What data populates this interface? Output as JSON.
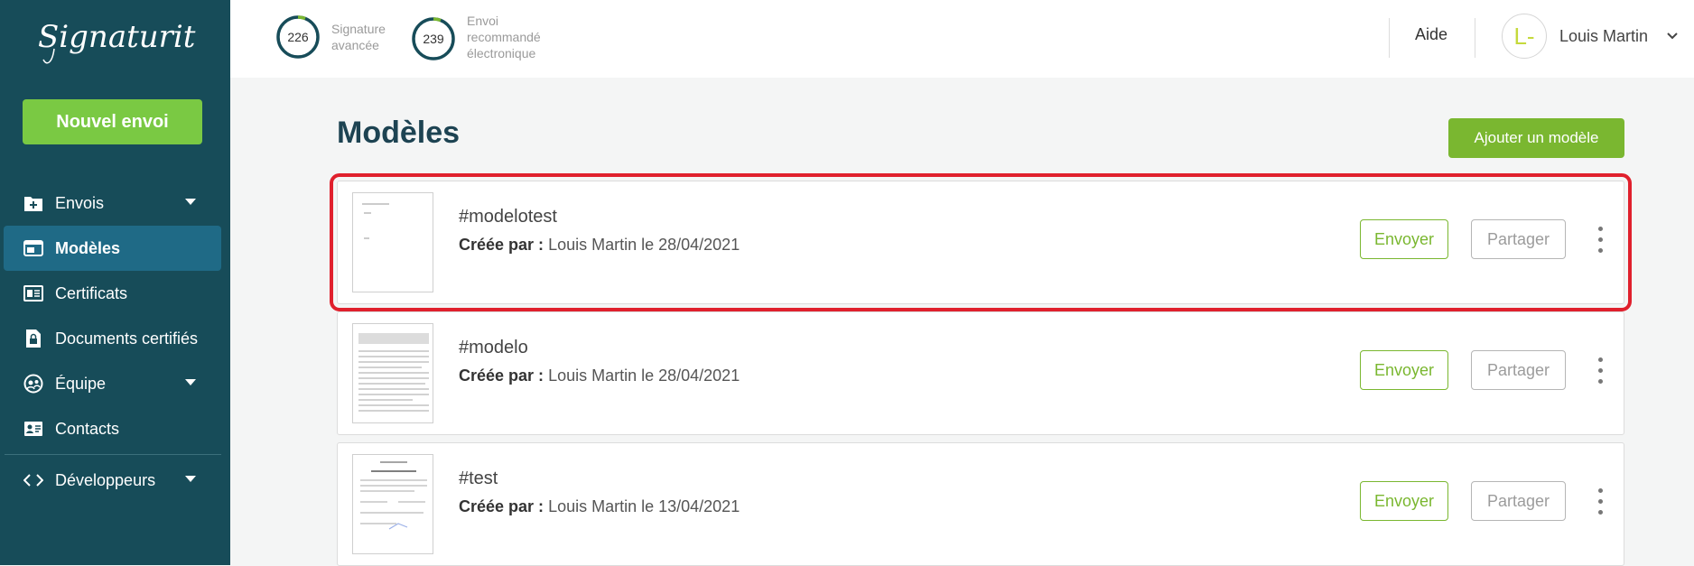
{
  "brand": {
    "logo_text": "Signaturit"
  },
  "sidebar": {
    "new_button": "Nouvel envoi",
    "items": [
      {
        "label": "Envois",
        "icon": "folder-plus-icon"
      },
      {
        "label": "Modèles",
        "icon": "template-icon"
      },
      {
        "label": "Certificats",
        "icon": "certificate-icon"
      },
      {
        "label": "Documents certifiés",
        "icon": "lock-document-icon"
      },
      {
        "label": "Équipe",
        "icon": "team-icon"
      },
      {
        "label": "Contacts",
        "icon": "contact-card-icon"
      },
      {
        "label": "Développeurs",
        "icon": "code-icon"
      }
    ]
  },
  "header": {
    "counters": [
      {
        "value": "226",
        "label": "Signature avancée"
      },
      {
        "value": "239",
        "label": "Envoi recommandé électronique"
      }
    ],
    "help": "Aide",
    "user": {
      "initials": "L-",
      "name": "Louis Martin"
    }
  },
  "main": {
    "title": "Modèles",
    "add_button": "Ajouter un modèle",
    "send_label": "Envoyer",
    "share_label": "Partager",
    "created_by_label": "Créée par :",
    "templates": [
      {
        "name": "#modelotest",
        "meta": "Louis Martin le 28/04/2021"
      },
      {
        "name": "#modelo",
        "meta": "Louis Martin le 28/04/2021"
      },
      {
        "name": "#test",
        "meta": "Louis Martin le 13/04/2021"
      }
    ]
  },
  "colors": {
    "sidebar_bg": "#174c59",
    "active_bg": "#1f6a86",
    "accent_green": "#7ab730",
    "highlight_red": "#e0202d"
  }
}
